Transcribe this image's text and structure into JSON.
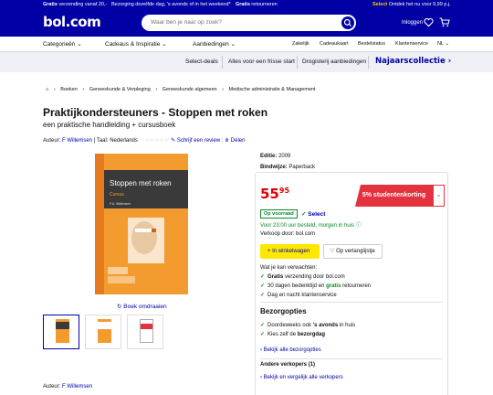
{
  "usp": {
    "gratis1": "Gratis",
    "text1": " verzending vanaf 20,-",
    "text2": "Bezorging dezelfde dag, 's avonds of in het weekend*",
    "gratis2": "Gratis",
    "text3": " retourneren",
    "select": "Select",
    "text4": " Ontdek het nu voor 9,99 p.j."
  },
  "header": {
    "logo": "bol.com",
    "search_placeholder": "Waar ben je naar op zoek?",
    "login": "Inloggen"
  },
  "nav": {
    "items": [
      "Categorieën",
      "Cadeaus & Inspiratie",
      "Aanbiedingen"
    ],
    "right": [
      "Zakelijk",
      "Cadeaukaart",
      "Bestelstatus",
      "Klantenservice",
      "NL"
    ]
  },
  "subnav": {
    "items": [
      "Select-deals",
      "Alles voor een frisse start",
      "Drogisterij aanbiedingen"
    ],
    "highlight": "Najaarscollectie"
  },
  "breadcrumbs": [
    "Boeken",
    "Geneeskunde & Verpleging",
    "Geneeskunde algemeen",
    "Medische administratie & Management"
  ],
  "product": {
    "title": "Praktijkondersteuners - Stoppen met roken",
    "subtitle": "een praktische handleiding + cursusboek",
    "author_label": "Auteur:",
    "author": "F Willemsen",
    "language_label": "| Taal:",
    "language": "Nederlands",
    "review_link": "Schrijf een review",
    "share_link": "Delen",
    "book_cover_title": "Stoppen met roken",
    "book_cover_sub": "Cursus",
    "book_cover_author": "F.A. Willemsen",
    "rotate": "Boek omdraaien"
  },
  "offer": {
    "editie_label": "Editie:",
    "editie": "2009",
    "binding_label": "Bindwijze:",
    "binding": "Paperback",
    "price_euros": "55",
    "price_cents": "95",
    "promo": "5% studentenkorting",
    "stock": "Op voorraad",
    "select": "Select",
    "delivery": "Voor 23:00 uur besteld, morgen in huis",
    "seller": "Verkoop door: bol.com",
    "cart_button": "In winkelwagen",
    "wish_button": "Op verlanglijstje",
    "expect_title": "Wat je kan verwachten:",
    "expect": [
      {
        "bold": "Gratis",
        "text": " verzending door bol.com"
      },
      {
        "pre": "30 dagen bedenktijd en ",
        "bold": "gratis",
        "text": " retourneren"
      },
      {
        "text": "Dag en nacht klantenservice"
      }
    ],
    "bezorg_title": "Bezorgopties",
    "bezorg": [
      {
        "pre": "Doordeweeks ook ",
        "bold": "'s avonds",
        "text": " in huis"
      },
      {
        "pre": "Kies zelf de ",
        "bold": "bezorgdag",
        "text": ""
      }
    ],
    "bezorg_link": "Bekijk alle bezorgopties",
    "other_sellers": "Andere verkopers (1)",
    "other_link": "Bekijk en vergelijk alle verkopers"
  },
  "bottom": {
    "author_label": "Auteur:",
    "author": "F Willemsen"
  },
  "colors": {
    "brand": "#0000a4",
    "price": "#e10000",
    "promo": "#e4323f",
    "green": "#0a8a2b",
    "cart": "#ffe800"
  }
}
